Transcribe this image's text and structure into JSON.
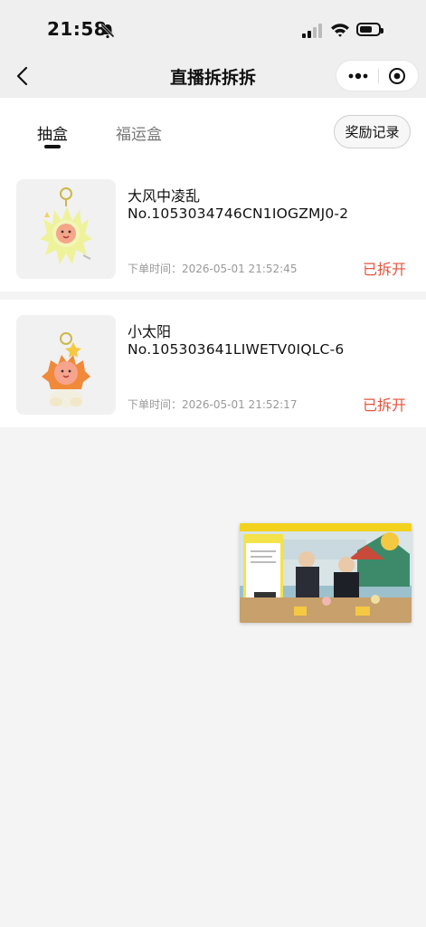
{
  "status_bar": {
    "time": "21:58",
    "icons": [
      "bell-off-icon",
      "signal-icon",
      "wifi-icon",
      "battery-icon"
    ]
  },
  "nav": {
    "title": "直播拆拆拆",
    "icons": [
      "back-icon",
      "more-dots-icon",
      "mini-program-close-icon"
    ]
  },
  "tabs": {
    "items": [
      {
        "label": "抽盒",
        "active": true
      },
      {
        "label": "福运盒",
        "active": false
      }
    ],
    "reward_button": "奖励记录"
  },
  "orders": [
    {
      "name": "大风中凌乱",
      "code": "No.1053034746CN1IOGZMJ0-2",
      "time": "下单时间：2026-05-01 21:52:45",
      "status": "已拆开"
    },
    {
      "name": "小太阳",
      "code": "No.105303641LIWETV0IQLC-6",
      "time": "下单时间：2026-05-01 21:52:17",
      "status": "已拆开"
    }
  ],
  "colors": {
    "status_opened": "#e5533c",
    "page_bg": "#f4f4f4",
    "header_bg": "#efefef"
  }
}
